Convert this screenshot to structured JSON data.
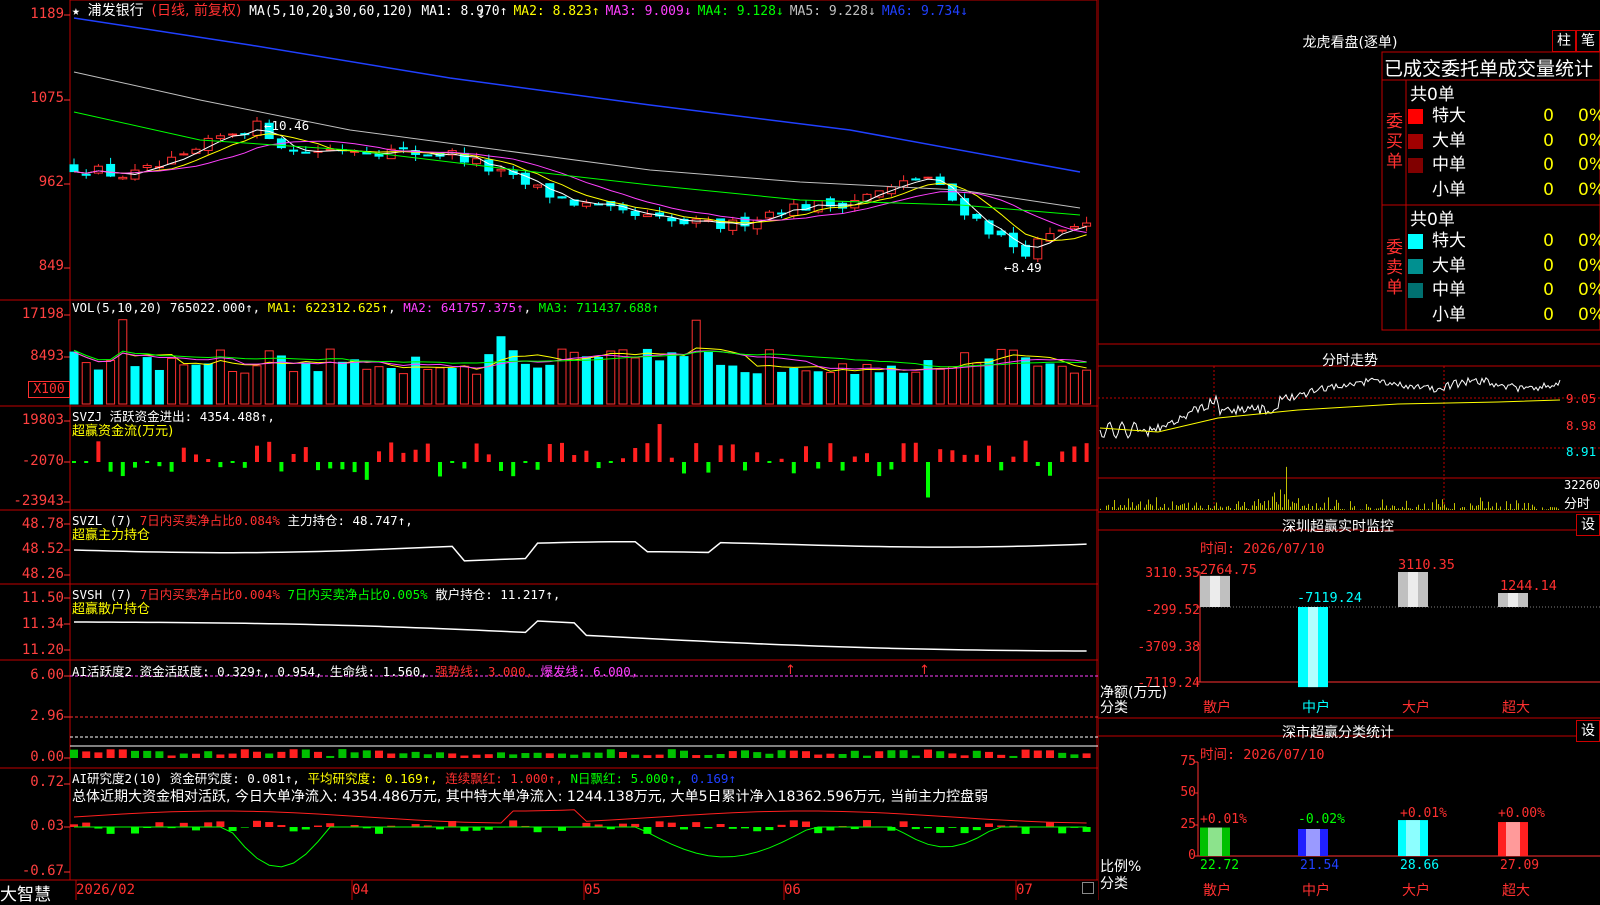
{
  "app": {
    "brand": "大智慧"
  },
  "kline": {
    "stock_name": "浦发银行",
    "period": "(日线, 前复权)",
    "ma_def": "MA(5,10,20,30,60,120)",
    "ma_items": [
      {
        "text": "MA1: 8.970↑",
        "color": "#ffffff"
      },
      {
        "text": "MA2: 8.823↑",
        "color": "#ffff00"
      },
      {
        "text": "MA3: 9.009↓",
        "color": "#ff40ff"
      },
      {
        "text": "MA4: 9.128↓",
        "color": "#00ff00"
      },
      {
        "text": "MA5: 9.228↓",
        "color": "#c0c0c0"
      },
      {
        "text": "MA6: 9.734↓",
        "color": "#2040ff"
      }
    ],
    "y_labels": [
      "1189",
      "1075",
      "962",
      "849"
    ],
    "y_values": [
      11.89,
      10.75,
      9.62,
      8.49
    ],
    "hi_mark": "10.46",
    "lo_mark": "8.49"
  },
  "vol": {
    "def": "VOL(5,10,20)",
    "value": "765022.000↑",
    "ma1": "MA1: 622312.625↑",
    "ma2": "MA2: 641757.375↑",
    "ma3": "MA3: 711437.688↑",
    "y_labels": [
      "17198",
      "8493"
    ],
    "unit": "X100"
  },
  "svzj": {
    "def": "SVZJ",
    "text": "活跃资金进出: 4354.488↑,",
    "sub": "超赢资金流(万元)",
    "y_labels": [
      "19803",
      "-2070",
      "-23943"
    ]
  },
  "svzl": {
    "def": "SVZL (7)",
    "red_text": "7日内买卖净占比0.084%",
    "white_text": "主力持仓: 48.747↑,",
    "sub": "超赢主力持仓",
    "y_labels": [
      "48.78",
      "48.52",
      "48.26"
    ]
  },
  "svsh": {
    "def": "SVSH (7)",
    "red_text": "7日内买卖净占比0.004%",
    "green_text": "7日内买卖净占比0.005%",
    "white_text": "散户持仓: 11.217↑,",
    "sub": "超赢散户持仓",
    "y_labels": [
      "11.50",
      "11.34",
      "11.20"
    ]
  },
  "ai1": {
    "def": "AI活跃度2",
    "w1": "资金活跃度: 0.329↑, 0.954, 生命线: 1.560,",
    "r1": "强势线: 3.000,",
    "m1": "爆发线: 6.000,",
    "y_labels": [
      "6.00",
      "2.96",
      "0.00"
    ]
  },
  "ai2": {
    "def": "AI研究度2(10)",
    "w1": "资金研究度: 0.081↑,",
    "y1": "平均研究度: 0.169↑,",
    "r1": "连续飘红: 1.000↑,",
    "g1": "N日飘红: 5.000↑,",
    "b1": "0.169↑",
    "summary": "总体近期大资金相对活跃, 今日大单净流入: 4354.486万元, 其中特大单净流入: 1244.138万元, 大单5日累计净入18362.596万元, 当前主力控盘弱",
    "y_labels": [
      "0.72",
      "0.03",
      "-0.67"
    ]
  },
  "xaxis": [
    "2026/02",
    "04",
    "05",
    "06",
    "07"
  ],
  "longhu": {
    "title": "龙虎看盘(逐单)",
    "btn1": "柱",
    "btn2": "笔",
    "header": "已成交委托单成交量统计",
    "buy_side": "委买单",
    "sell_side": "委卖单",
    "buy_total": "共0单",
    "sell_total": "共0单",
    "buy_rows": [
      {
        "name": "特大",
        "count": "0",
        "pct": "0%",
        "color": "#ff0000"
      },
      {
        "name": "大单",
        "count": "0",
        "pct": "0%",
        "color": "#a00000"
      },
      {
        "name": "中单",
        "count": "0",
        "pct": "0%",
        "color": "#800000"
      },
      {
        "name": "小单",
        "count": "0",
        "pct": "0%",
        "color": "#000000"
      }
    ],
    "sell_rows": [
      {
        "name": "特大",
        "count": "0",
        "pct": "0%",
        "color": "#00ffff"
      },
      {
        "name": "大单",
        "count": "0",
        "pct": "0%",
        "color": "#009090"
      },
      {
        "name": "中单",
        "count": "0",
        "pct": "0%",
        "color": "#007070"
      },
      {
        "name": "小单",
        "count": "0",
        "pct": "0%",
        "color": "#000000"
      }
    ]
  },
  "intraday": {
    "title": "分时走势",
    "y_labels": [
      "9.05",
      "8.98",
      "8.91"
    ],
    "vol_label": "32260",
    "vol_unit": "分时"
  },
  "monitor": {
    "title": "深圳超赢实时监控",
    "set": "设",
    "time": "时间: 2026/07/10",
    "y_labels": [
      "3110.35",
      "-299.52",
      "-3709.38",
      "-7119.24"
    ],
    "ylabel": "净额(万元)",
    "xlabel": "分类",
    "categories": [
      "散户",
      "中户",
      "大户",
      "超大"
    ],
    "values": [
      2764.75,
      -7119.24,
      3110.35,
      1244.14
    ],
    "value_labels": [
      "2764.75",
      "-7119.24",
      "3110.35",
      "1244.14"
    ]
  },
  "classify": {
    "title": "深市超赢分类统计",
    "set": "设",
    "time": "时间: 2026/07/10",
    "y_labels": [
      "75",
      "50",
      "25",
      "0"
    ],
    "ylabel": "比例%",
    "xlabel": "分类",
    "categories": [
      "散户",
      "中户",
      "大户",
      "超大"
    ],
    "values": [
      22.72,
      21.54,
      28.66,
      27.09
    ],
    "value_labels": [
      "22.72",
      "21.54",
      "28.66",
      "27.09"
    ],
    "change_labels": [
      "+0.01%",
      "-0.02%",
      "+0.01%",
      "+0.00%"
    ],
    "bar_colors": [
      "#00c000",
      "#2020ff",
      "#00ffff",
      "#ff2020"
    ]
  },
  "chart_data": [
    {
      "type": "bar",
      "title": "深圳超赢实时监控",
      "categories": [
        "散户",
        "中户",
        "大户",
        "超大"
      ],
      "values": [
        2764.75,
        -7119.24,
        3110.35,
        1244.14
      ],
      "ylabel": "净额(万元)",
      "xlabel": "分类",
      "ylim": [
        -7119.24,
        3110.35
      ]
    },
    {
      "type": "bar",
      "title": "深市超赢分类统计",
      "categories": [
        "散户",
        "中户",
        "大户",
        "超大"
      ],
      "values": [
        22.72,
        21.54,
        28.66,
        27.09
      ],
      "ylabel": "比例%",
      "xlabel": "分类",
      "ylim": [
        0,
        75
      ]
    }
  ]
}
